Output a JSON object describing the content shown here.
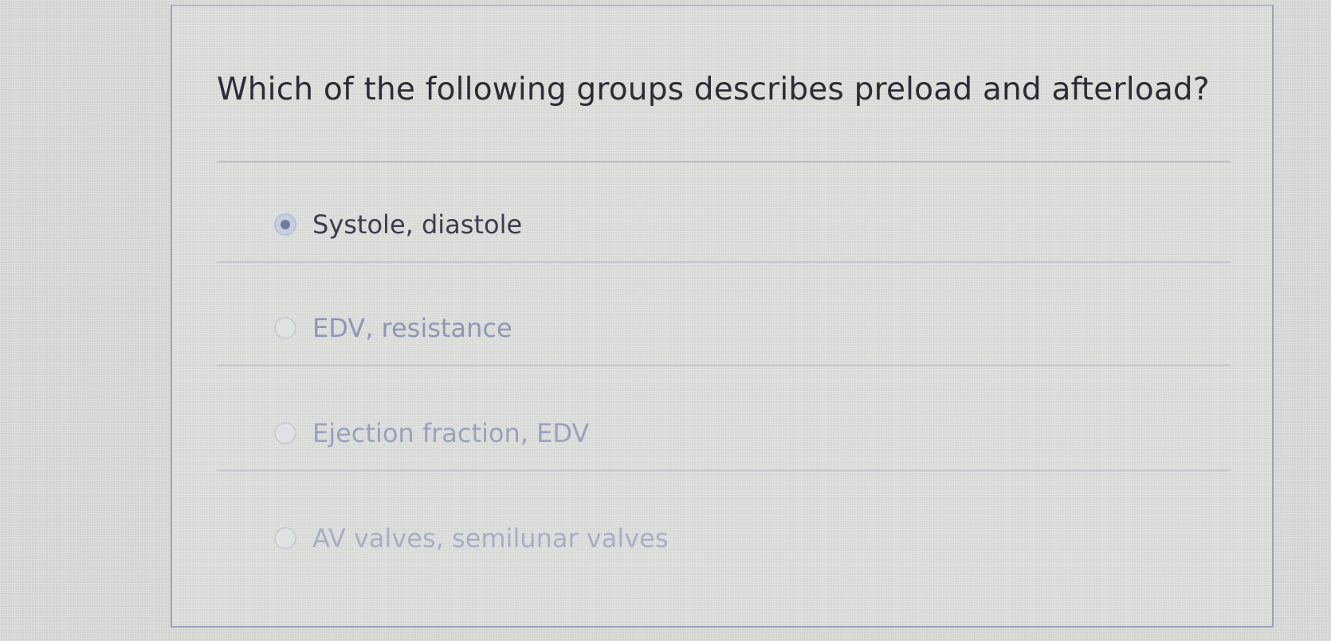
{
  "question": {
    "text": "Which of the following groups describes preload and afterload?"
  },
  "options": [
    {
      "label": "Systole, diastole",
      "selected": true
    },
    {
      "label": "EDV, resistance",
      "selected": false
    },
    {
      "label": "Ejection fraction, EDV",
      "selected": false
    },
    {
      "label": "AV valves, semilunar valves",
      "selected": false
    }
  ],
  "colors": {
    "question_text": "#2b2c34",
    "selected_text": "#3a3d4a",
    "unselected_text": "#8f97b6",
    "radio_selected_dot": "#6f7c9f",
    "card_border": "#9aa2b8"
  }
}
